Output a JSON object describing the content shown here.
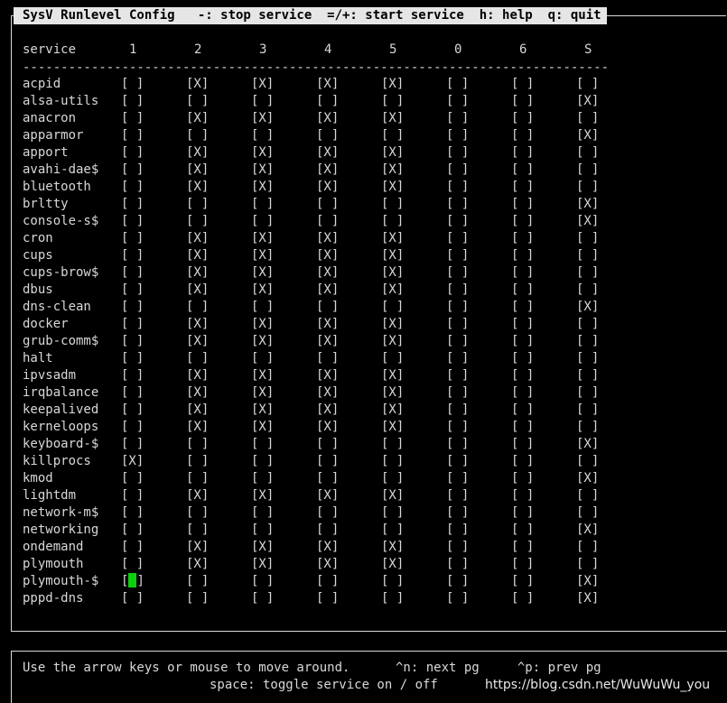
{
  "title_bar": "SysV Runlevel Config   -: stop service  =/+: start service  h: help  q: quit",
  "header": {
    "service_label": "service",
    "runlevels": [
      "1",
      "2",
      "3",
      "4",
      "5",
      "0",
      "6",
      "S"
    ]
  },
  "separator": "-----------------------------------------------------------------------------",
  "marks": {
    "on": "[X]",
    "off": "[ ]"
  },
  "services": [
    {
      "name": "acpid",
      "states": [
        0,
        1,
        1,
        1,
        1,
        0,
        0,
        0
      ]
    },
    {
      "name": "alsa-utils",
      "states": [
        0,
        0,
        0,
        0,
        0,
        0,
        0,
        1
      ]
    },
    {
      "name": "anacron",
      "states": [
        0,
        1,
        1,
        1,
        1,
        0,
        0,
        0
      ]
    },
    {
      "name": "apparmor",
      "states": [
        0,
        0,
        0,
        0,
        0,
        0,
        0,
        1
      ]
    },
    {
      "name": "apport",
      "states": [
        0,
        1,
        1,
        1,
        1,
        0,
        0,
        0
      ]
    },
    {
      "name": "avahi-dae$",
      "states": [
        0,
        1,
        1,
        1,
        1,
        0,
        0,
        0
      ]
    },
    {
      "name": "bluetooth",
      "states": [
        0,
        1,
        1,
        1,
        1,
        0,
        0,
        0
      ]
    },
    {
      "name": "brltty",
      "states": [
        0,
        0,
        0,
        0,
        0,
        0,
        0,
        1
      ]
    },
    {
      "name": "console-s$",
      "states": [
        0,
        0,
        0,
        0,
        0,
        0,
        0,
        1
      ]
    },
    {
      "name": "cron",
      "states": [
        0,
        1,
        1,
        1,
        1,
        0,
        0,
        0
      ]
    },
    {
      "name": "cups",
      "states": [
        0,
        1,
        1,
        1,
        1,
        0,
        0,
        0
      ]
    },
    {
      "name": "cups-brow$",
      "states": [
        0,
        1,
        1,
        1,
        1,
        0,
        0,
        0
      ]
    },
    {
      "name": "dbus",
      "states": [
        0,
        1,
        1,
        1,
        1,
        0,
        0,
        0
      ]
    },
    {
      "name": "dns-clean",
      "states": [
        0,
        0,
        0,
        0,
        0,
        0,
        0,
        1
      ]
    },
    {
      "name": "docker",
      "states": [
        0,
        1,
        1,
        1,
        1,
        0,
        0,
        0
      ]
    },
    {
      "name": "grub-comm$",
      "states": [
        0,
        1,
        1,
        1,
        1,
        0,
        0,
        0
      ]
    },
    {
      "name": "halt",
      "states": [
        0,
        0,
        0,
        0,
        0,
        0,
        0,
        0
      ]
    },
    {
      "name": "ipvsadm",
      "states": [
        0,
        1,
        1,
        1,
        1,
        0,
        0,
        0
      ]
    },
    {
      "name": "irqbalance",
      "states": [
        0,
        1,
        1,
        1,
        1,
        0,
        0,
        0
      ]
    },
    {
      "name": "keepalived",
      "states": [
        0,
        1,
        1,
        1,
        1,
        0,
        0,
        0
      ]
    },
    {
      "name": "kerneloops",
      "states": [
        0,
        1,
        1,
        1,
        1,
        0,
        0,
        0
      ]
    },
    {
      "name": "keyboard-$",
      "states": [
        0,
        0,
        0,
        0,
        0,
        0,
        0,
        1
      ]
    },
    {
      "name": "killprocs",
      "states": [
        1,
        0,
        0,
        0,
        0,
        0,
        0,
        0
      ]
    },
    {
      "name": "kmod",
      "states": [
        0,
        0,
        0,
        0,
        0,
        0,
        0,
        1
      ]
    },
    {
      "name": "lightdm",
      "states": [
        0,
        1,
        1,
        1,
        1,
        0,
        0,
        0
      ]
    },
    {
      "name": "network-m$",
      "states": [
        0,
        0,
        0,
        0,
        0,
        0,
        0,
        0
      ]
    },
    {
      "name": "networking",
      "states": [
        0,
        0,
        0,
        0,
        0,
        0,
        0,
        1
      ]
    },
    {
      "name": "ondemand",
      "states": [
        0,
        1,
        1,
        1,
        1,
        0,
        0,
        0
      ]
    },
    {
      "name": "plymouth",
      "states": [
        0,
        1,
        1,
        1,
        1,
        0,
        0,
        0
      ]
    },
    {
      "name": "plymouth-$",
      "states": [
        0,
        0,
        0,
        0,
        0,
        0,
        0,
        1
      ]
    },
    {
      "name": "pppd-dns",
      "states": [
        0,
        0,
        0,
        0,
        0,
        0,
        0,
        1
      ]
    }
  ],
  "cursor": {
    "row": 29,
    "col": 0
  },
  "help_line1": "Use the arrow keys or mouse to move around.      ^n: next pg     ^p: prev pg",
  "help_line2": "space: toggle service on / off",
  "watermark": "https://blog.csdn.net/WuWuWu_you",
  "colors": {
    "background": "#000000",
    "text": "#d8d8d8",
    "title_bg": "#e6e6e6",
    "cursor": "#0bd10b"
  }
}
